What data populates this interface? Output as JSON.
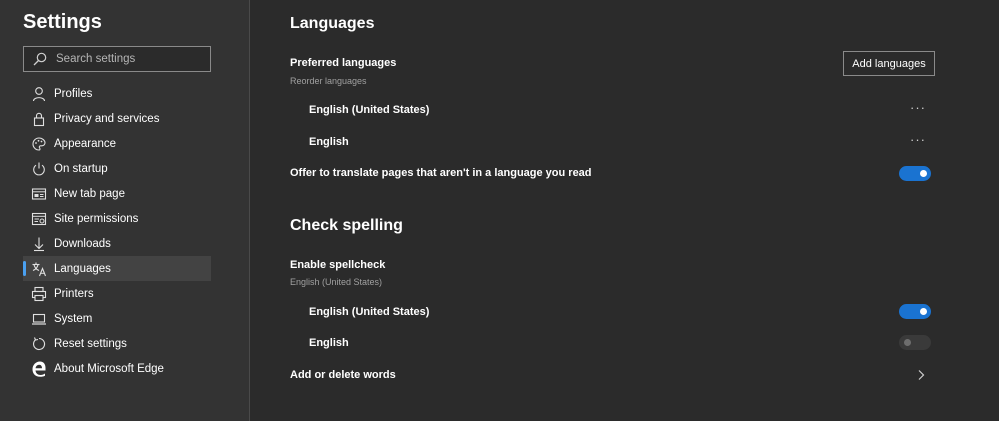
{
  "sidebar": {
    "title": "Settings",
    "search_placeholder": "Search settings",
    "items": [
      {
        "label": "Profiles",
        "icon": "person-icon"
      },
      {
        "label": "Privacy and services",
        "icon": "lock-icon"
      },
      {
        "label": "Appearance",
        "icon": "palette-icon"
      },
      {
        "label": "On startup",
        "icon": "power-icon"
      },
      {
        "label": "New tab page",
        "icon": "new-tab-icon"
      },
      {
        "label": "Site permissions",
        "icon": "site-permissions-icon"
      },
      {
        "label": "Downloads",
        "icon": "download-icon"
      },
      {
        "label": "Languages",
        "icon": "languages-icon",
        "active": true
      },
      {
        "label": "Printers",
        "icon": "printer-icon"
      },
      {
        "label": "System",
        "icon": "laptop-icon"
      },
      {
        "label": "Reset settings",
        "icon": "reset-icon"
      },
      {
        "label": "About Microsoft Edge",
        "icon": "edge-logo-icon"
      }
    ]
  },
  "main": {
    "languages": {
      "heading": "Languages",
      "preferred_label": "Preferred languages",
      "preferred_sublabel": "Reorder languages",
      "add_button": "Add languages",
      "list": [
        {
          "name": "English (United States)",
          "more": "···"
        },
        {
          "name": "English",
          "more": "···"
        }
      ],
      "offer_translate_label": "Offer to translate pages that aren't in a language you read",
      "offer_translate_on": true
    },
    "spelling": {
      "heading": "Check spelling",
      "enable_label": "Enable spellcheck",
      "enable_sublabel": "English (United States)",
      "list": [
        {
          "name": "English (United States)",
          "on": true
        },
        {
          "name": "English",
          "on": false
        }
      ],
      "add_delete_words": "Add or delete words"
    }
  },
  "colors": {
    "background": "#2b2b2b",
    "sidebar": "#333333",
    "accent": "#1a73d1",
    "active_indicator": "#4aa0f0"
  }
}
